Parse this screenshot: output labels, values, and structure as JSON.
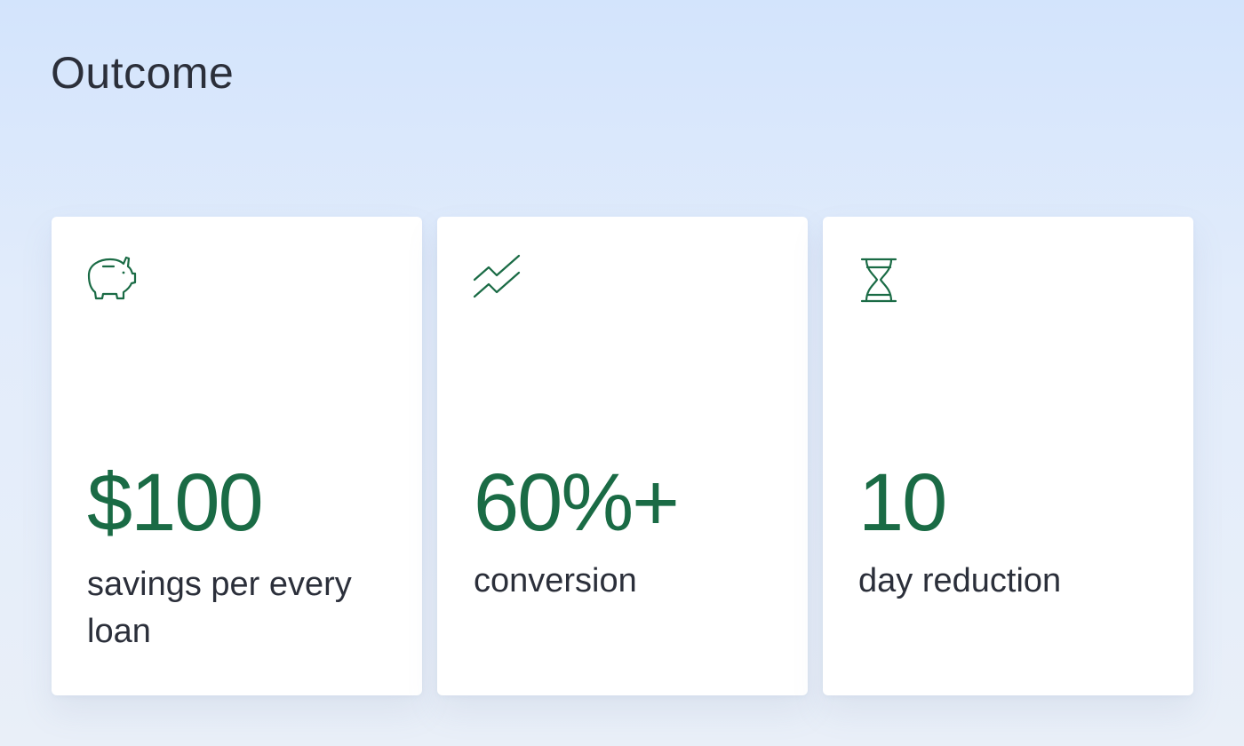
{
  "header": {
    "title": "Outcome"
  },
  "theme": {
    "accent": "#1a6b45",
    "text": "#2b2f3a",
    "card_background": "#ffffff"
  },
  "cards": [
    {
      "icon": "piggy-bank-icon",
      "value": "$100",
      "label": "savings per every loan"
    },
    {
      "icon": "trend-up-icon",
      "value": "60%+",
      "label": "conversion"
    },
    {
      "icon": "hourglass-icon",
      "value": "10",
      "label": "day reduction"
    }
  ]
}
